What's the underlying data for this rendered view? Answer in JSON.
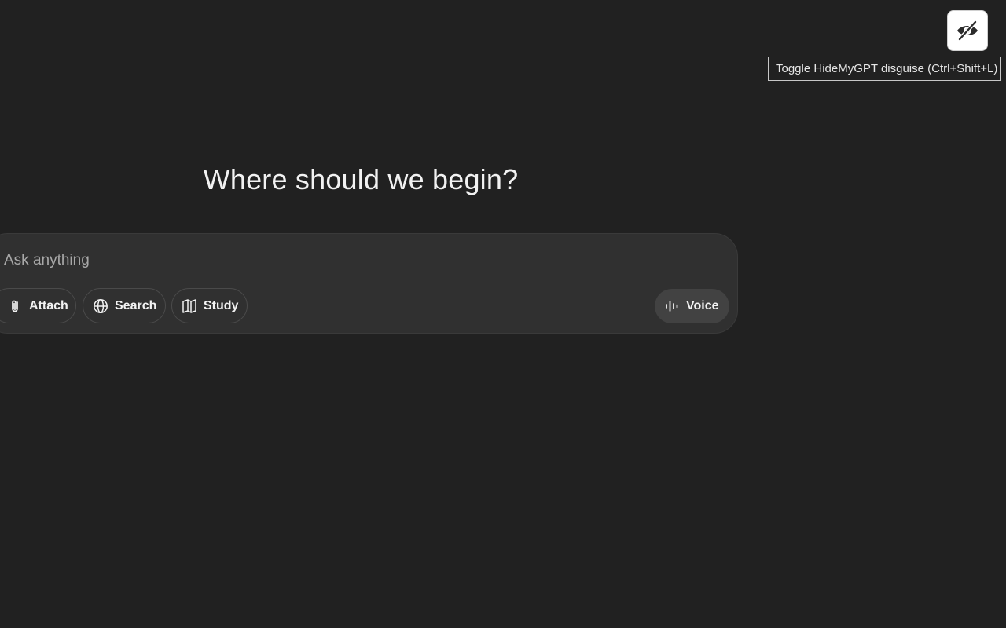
{
  "toggle": {
    "icon": "eye-off-icon",
    "tooltip": "Toggle HideMyGPT disguise (Ctrl+Shift+L)"
  },
  "main": {
    "headline": "Where should we begin?"
  },
  "composer": {
    "placeholder": "Ask anything",
    "value": "",
    "buttons": {
      "attach": {
        "label": "Attach",
        "icon": "paperclip-icon"
      },
      "search": {
        "label": "Search",
        "icon": "globe-icon"
      },
      "study": {
        "label": "Study",
        "icon": "book-icon"
      },
      "voice": {
        "label": "Voice",
        "icon": "waveform-icon"
      }
    }
  },
  "colors": {
    "background": "#212121",
    "composer": "#303030",
    "voice_button": "#424242",
    "text": "#ececec"
  }
}
